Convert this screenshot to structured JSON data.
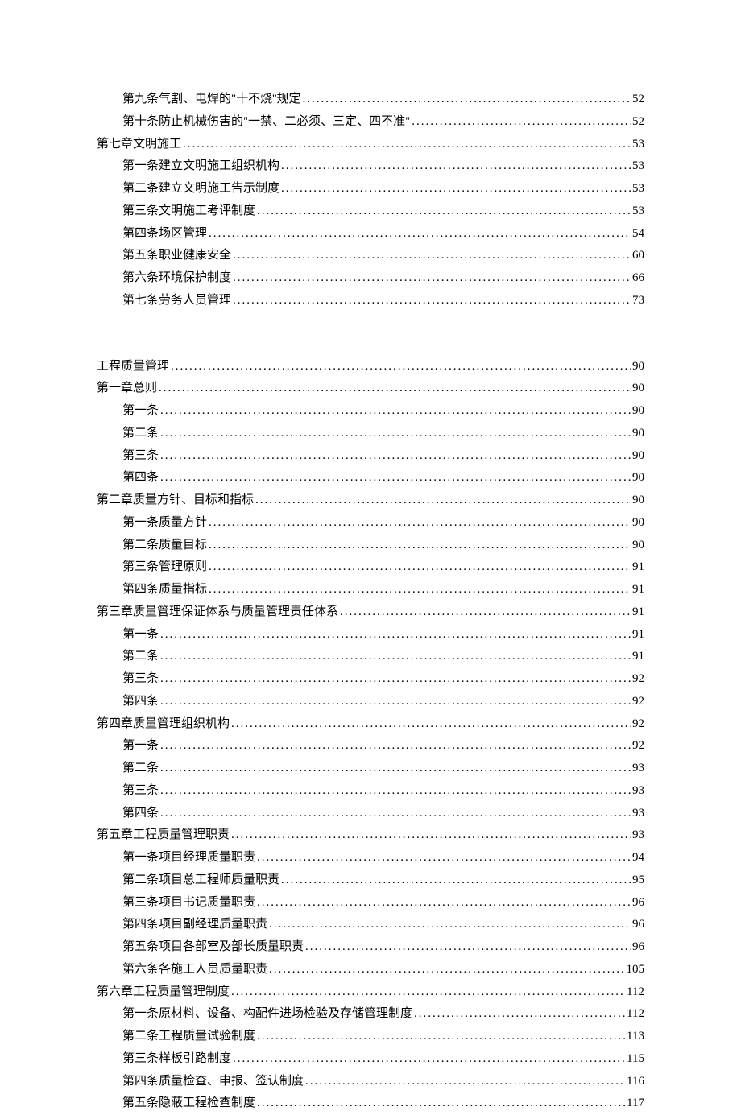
{
  "toc": [
    {
      "level": 2,
      "label": "第九条气割、电焊的\"十不烧''规定",
      "page": "52"
    },
    {
      "level": 2,
      "label": "第十条防止机械伤害的\"一禁、二必须、三定、四不准\"",
      "page": "52"
    },
    {
      "level": 1,
      "label": "第七章文明施工",
      "page": "53"
    },
    {
      "level": 2,
      "label": "第一条建立文明施工组织机构",
      "page": "53"
    },
    {
      "level": 2,
      "label": "第二条建立文明施工告示制度",
      "page": "53"
    },
    {
      "level": 2,
      "label": "第三条文明施工考评制度",
      "page": "53"
    },
    {
      "level": 2,
      "label": "第四条场区管理",
      "page": "54"
    },
    {
      "level": 2,
      "label": "第五条职业健康安全",
      "page": "60"
    },
    {
      "level": 2,
      "label": "第六条环境保护制度",
      "page": "66"
    },
    {
      "level": 2,
      "label": "第七条劳务人员管理",
      "page": "73"
    },
    {
      "gap": true
    },
    {
      "level": 1,
      "label": "工程质量管理",
      "page": "90"
    },
    {
      "level": 1,
      "label": "第一章总则",
      "page": "90"
    },
    {
      "level": 2,
      "label": "第一条",
      "page": "90"
    },
    {
      "level": 2,
      "label": "第二条",
      "page": "90"
    },
    {
      "level": 2,
      "label": "第三条",
      "page": "90"
    },
    {
      "level": 2,
      "label": "第四条",
      "page": "90"
    },
    {
      "level": 1,
      "label": "第二章质量方针、目标和指标",
      "page": "90"
    },
    {
      "level": 2,
      "label": "第一条质量方针",
      "page": "90"
    },
    {
      "level": 2,
      "label": "第二条质量目标",
      "page": "90"
    },
    {
      "level": 2,
      "label": "第三条管理原则",
      "page": "91"
    },
    {
      "level": 2,
      "label": "第四条质量指标",
      "page": "91"
    },
    {
      "level": 1,
      "label": "第三章质量管理保证体系与质量管理责任体系",
      "page": "91"
    },
    {
      "level": 2,
      "label": "第一条",
      "page": "91"
    },
    {
      "level": 2,
      "label": "第二条",
      "page": "91"
    },
    {
      "level": 2,
      "label": "第三条",
      "page": "92"
    },
    {
      "level": 2,
      "label": "第四条",
      "page": "92"
    },
    {
      "level": 1,
      "label": "第四章质量管理组织机构",
      "page": "92"
    },
    {
      "level": 2,
      "label": "第一条",
      "page": "92"
    },
    {
      "level": 2,
      "label": "第二条",
      "page": "93"
    },
    {
      "level": 2,
      "label": "第三条",
      "page": "93"
    },
    {
      "level": 2,
      "label": "第四条",
      "page": "93"
    },
    {
      "level": 1,
      "label": "第五章工程质量管理职责",
      "page": "93"
    },
    {
      "level": 2,
      "label": "第一条项目经理质量职责",
      "page": "94"
    },
    {
      "level": 2,
      "label": "第二条项目总工程师质量职责",
      "page": "95"
    },
    {
      "level": 2,
      "label": "第三条项目书记质量职责",
      "page": "96"
    },
    {
      "level": 2,
      "label": "第四条项目副经理质量职责",
      "page": "96"
    },
    {
      "level": 2,
      "label": "第五条项目各部室及部长质量职责",
      "page": "96"
    },
    {
      "level": 2,
      "label": "第六条各施工人员质量职责",
      "page": "105"
    },
    {
      "level": 1,
      "label": "第六章工程质量管理制度",
      "page": "112"
    },
    {
      "level": 2,
      "label": "第一条原材料、设备、构配件进场检验及存储管理制度",
      "page": "112"
    },
    {
      "level": 2,
      "label": "第二条工程质量试验制度",
      "page": "113"
    },
    {
      "level": 2,
      "label": "第三条样板引路制度",
      "page": "115"
    },
    {
      "level": 2,
      "label": "第四条质量检查、申报、签认制度",
      "page": "116"
    },
    {
      "level": 2,
      "label": "第五条隐蔽工程检查制度",
      "page": "117"
    }
  ]
}
